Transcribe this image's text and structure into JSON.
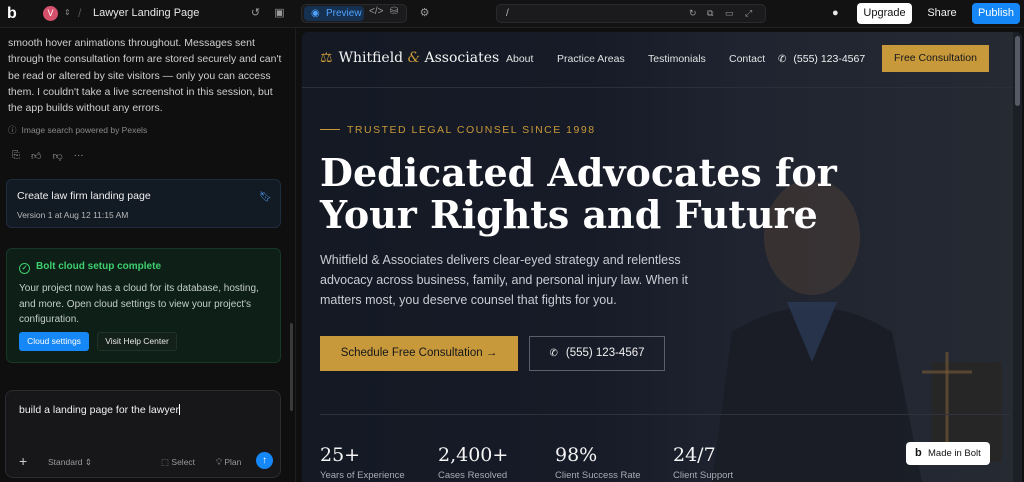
{
  "topbar": {
    "logo": "b",
    "avatar_initial": "V",
    "project_title": "Lawyer Landing Page",
    "preview_label": "Preview",
    "url": "/",
    "upgrade": "Upgrade",
    "share": "Share",
    "publish": "Publish"
  },
  "chat": {
    "message": "smooth hover animations throughout. Messages sent through the consultation form are stored securely and can't be read or altered by site visitors — only you can access them. I couldn't take a live screenshot in this session, but the app builds without any errors.",
    "pexels_note": "Image search powered by Pexels",
    "version_card": {
      "title": "Create law firm landing page",
      "subtitle": "Version 1 at Aug 12 11:15 AM"
    },
    "cloud_card": {
      "title": "Bolt cloud setup complete",
      "body": "Your project now has a cloud for its database, hosting, and more. Open cloud settings to view your project's configuration.",
      "cloud_button": "Cloud settings",
      "help_button": "Visit Help Center"
    },
    "prompt": {
      "value": "build a landing page for the lawyer",
      "mode": "Standard",
      "select": "Select",
      "plan": "Plan"
    }
  },
  "site": {
    "brand_prefix": "Whitfield",
    "brand_amp": "&",
    "brand_suffix": "Associates",
    "nav": [
      "About",
      "Practice Areas",
      "Testimonials",
      "Contact"
    ],
    "phone": "(555) 123-4567",
    "cta_nav": "Free Consultation",
    "eyebrow": "TRUSTED LEGAL COUNSEL SINCE 1998",
    "headline": "Dedicated Advocates for Your Rights and Future",
    "lede": "Whitfield & Associates delivers clear-eyed strategy and relentless advocacy across business, family, and personal injury law. When it matters most, you deserve counsel that fights for you.",
    "cta_primary": "Schedule Free Consultation",
    "cta_secondary": "(555) 123-4567",
    "stats": [
      {
        "num": "25+",
        "label": "Years of Experience"
      },
      {
        "num": "2,400+",
        "label": "Cases Resolved"
      },
      {
        "num": "98%",
        "label": "Client Success Rate"
      },
      {
        "num": "24/7",
        "label": "Client Support"
      }
    ],
    "made_in_bolt": "Made in Bolt"
  },
  "colors": {
    "accent_gold": "#c8993a",
    "brand_blue": "#1587f7",
    "success_green": "#3ecf6e"
  }
}
